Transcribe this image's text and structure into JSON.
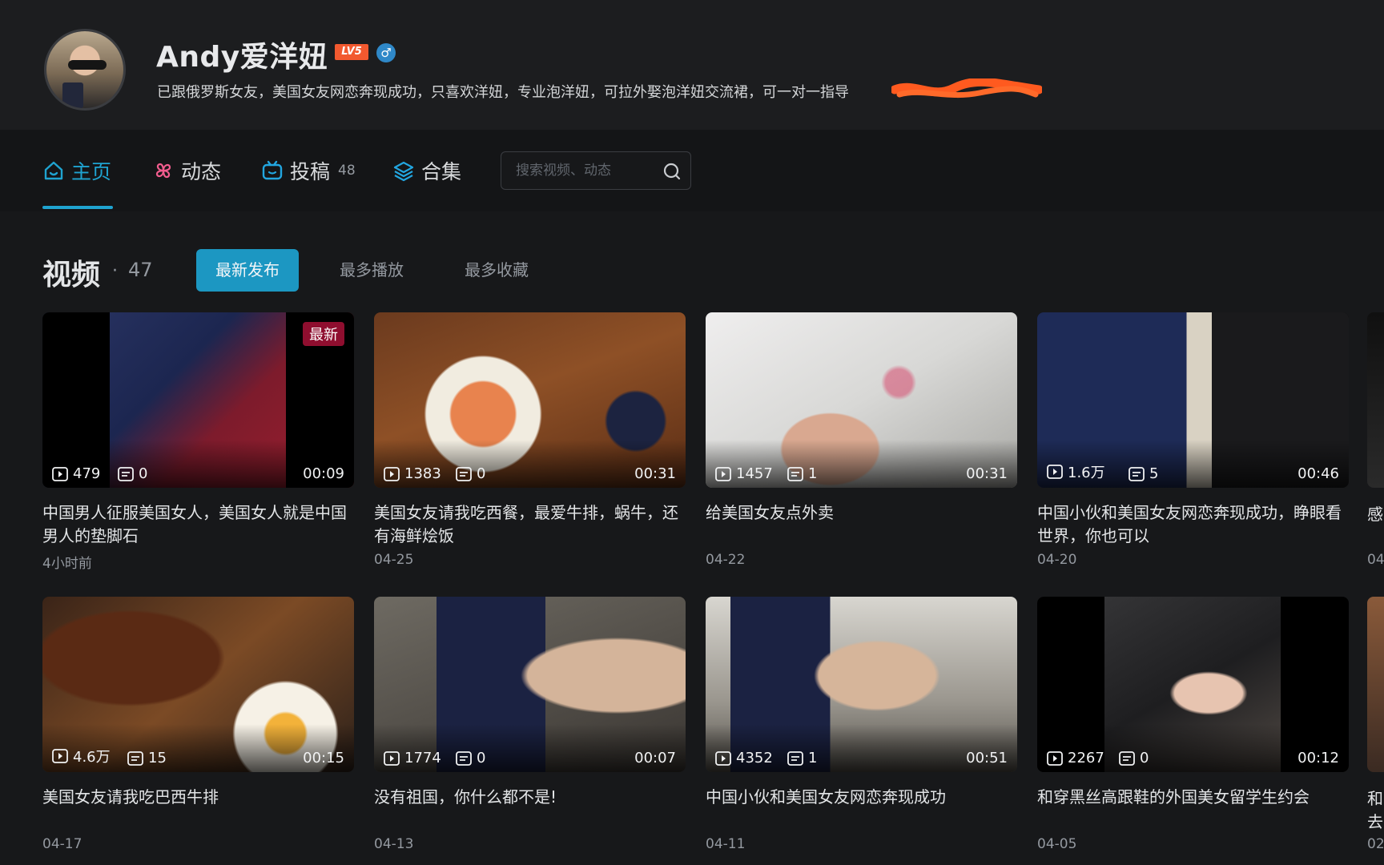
{
  "profile": {
    "name": "Andy爱洋妞",
    "level": "LV5",
    "gender_symbol": "♂",
    "bio": "已跟俄罗斯女友，美国女友网恋奔现成功，只喜欢洋妞，专业泡洋妞，可拉外娶泡洋妞交流裙，可一对一指导"
  },
  "nav": {
    "home": "主页",
    "dynamic": "动态",
    "uploads": "投稿",
    "uploads_count": "48",
    "collections": "合集",
    "search_placeholder": "搜索视频、动态"
  },
  "section": {
    "title": "视频",
    "dot": "·",
    "count": "47",
    "sort_options": [
      "最新发布",
      "最多播放",
      "最多收藏"
    ]
  },
  "colors": {
    "accent": "#1fa3d0",
    "background": "#17181a",
    "newest_badge": "#8f0e2f",
    "level_badge": "#f2592f"
  },
  "videos": [
    {
      "title": "中国男人征服美国女人，美国女人就是中国男人的垫脚石",
      "plays": "479",
      "comments": "0",
      "duration": "00:09",
      "date": "4小时前",
      "badge": "最新"
    },
    {
      "title": "美国女友请我吃西餐，最爱牛排，蜗牛，还有海鲜烩饭",
      "plays": "1383",
      "comments": "0",
      "duration": "00:31",
      "date": "04-25"
    },
    {
      "title": "给美国女友点外卖",
      "plays": "1457",
      "comments": "1",
      "duration": "00:31",
      "date": "04-22"
    },
    {
      "title": "中国小伙和美国女友网恋奔现成功，睁眼看世界，你也可以",
      "plays": "1.6万",
      "comments": "5",
      "duration": "00:46",
      "date": "04-20"
    },
    {
      "title": "美国女友请我吃巴西牛排",
      "plays": "4.6万",
      "comments": "15",
      "duration": "00:15",
      "date": "04-17"
    },
    {
      "title": "没有祖国，你什么都不是!",
      "plays": "1774",
      "comments": "0",
      "duration": "00:07",
      "date": "04-13"
    },
    {
      "title": "中国小伙和美国女友网恋奔现成功",
      "plays": "4352",
      "comments": "1",
      "duration": "00:51",
      "date": "04-11"
    },
    {
      "title": "和穿黑丝高跟鞋的外国美女留学生约会",
      "plays": "2267",
      "comments": "0",
      "duration": "00:12",
      "date": "04-05"
    }
  ],
  "peek": {
    "row1_title": "感",
    "row1_date": "04",
    "row2_title1": "和",
    "row2_title2": "去",
    "row2_date": "02"
  }
}
